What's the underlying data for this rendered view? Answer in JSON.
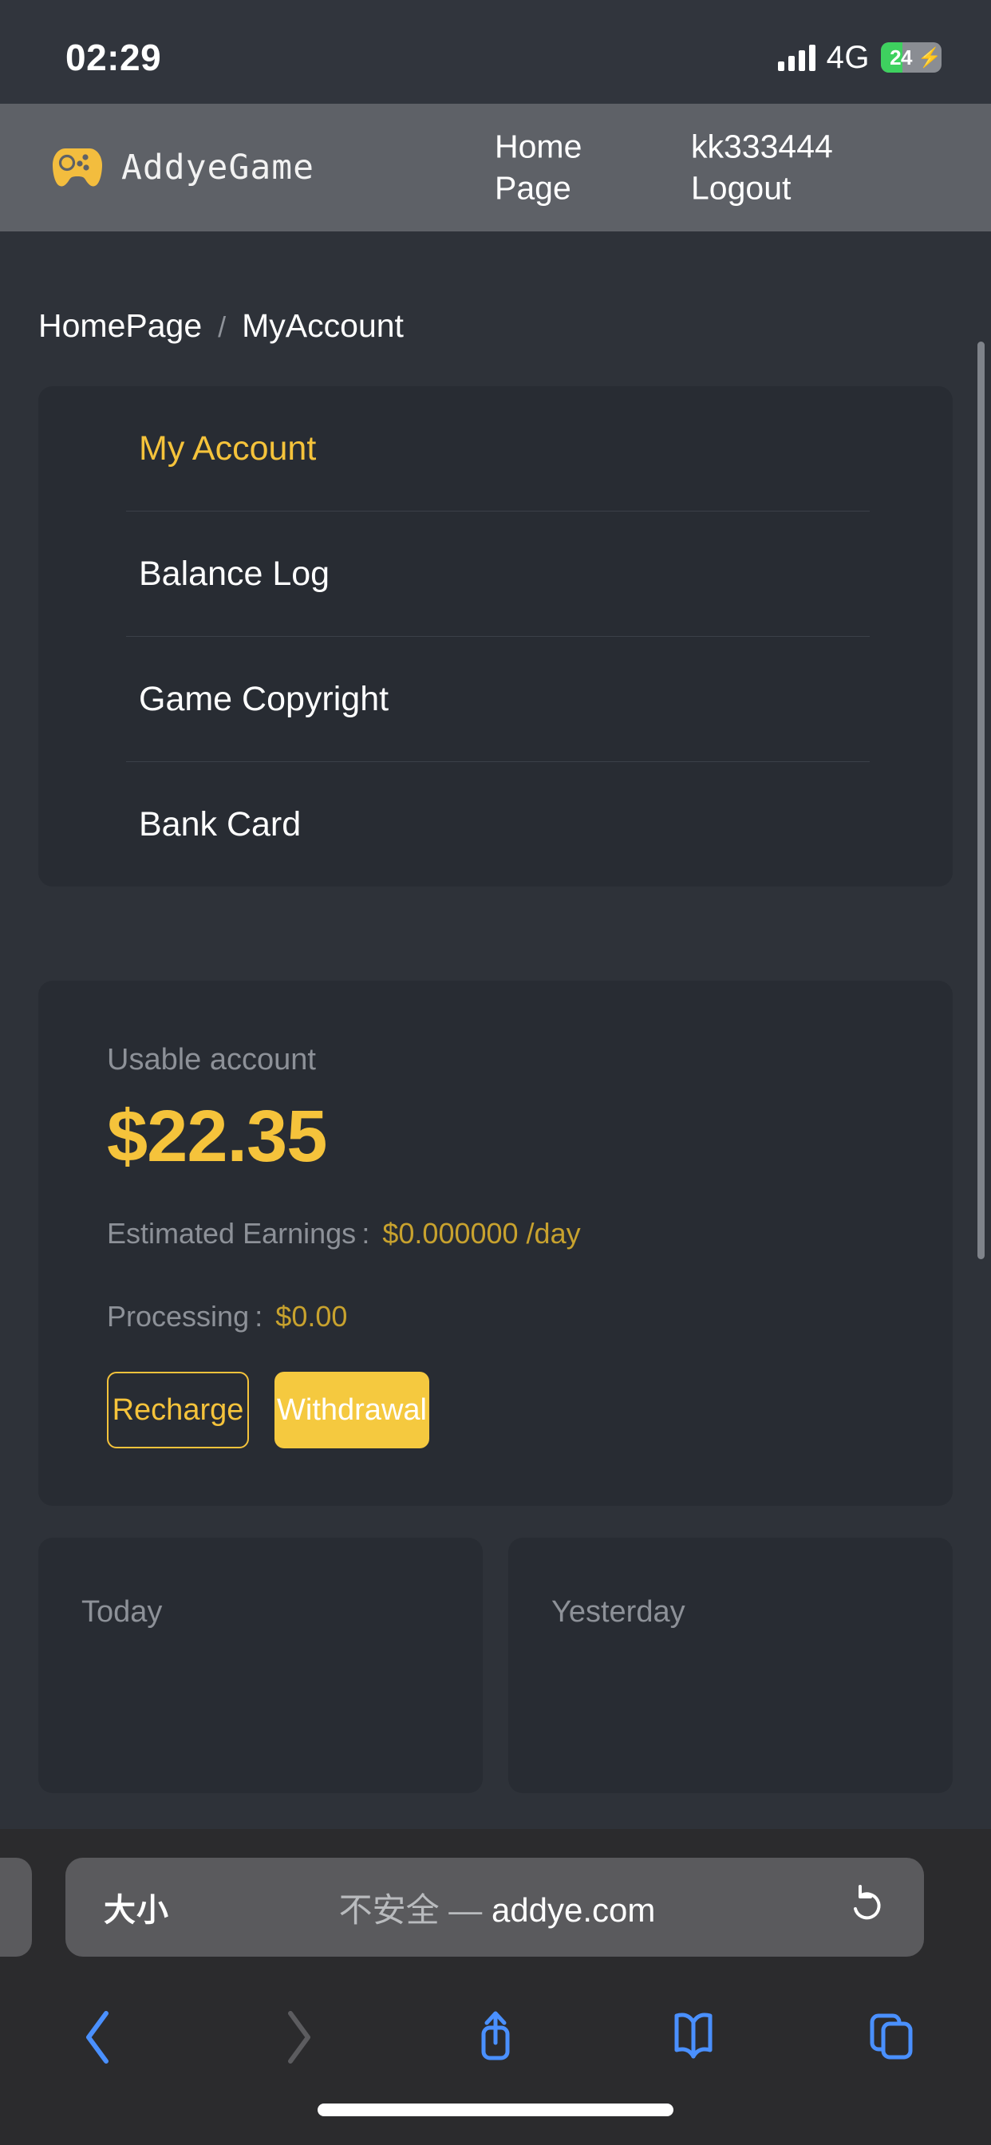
{
  "status_bar": {
    "time": "02:29",
    "network": "4G",
    "battery_percent": "24",
    "battery_charging_icon": "bolt-icon",
    "signal_icon": "signal-bars-icon"
  },
  "header": {
    "logo_icon": "gamepad-icon",
    "brand": "AddyeGame",
    "nav_home": "Home Page",
    "username": "kk333444",
    "logout": "Logout"
  },
  "breadcrumb": {
    "home": "HomePage",
    "separator": "/",
    "current": "MyAccount"
  },
  "menu": {
    "items": [
      {
        "label": "My Account",
        "active": true
      },
      {
        "label": "Balance Log",
        "active": false
      },
      {
        "label": "Game Copyright",
        "active": false
      },
      {
        "label": "Bank Card",
        "active": false
      }
    ]
  },
  "balance": {
    "usable_label": "Usable account",
    "amount": "$22.35",
    "earnings_label": "Estimated Earnings :",
    "earnings_value": "$0.000000 /day",
    "processing_label": "Processing :",
    "processing_value": "$0.00",
    "recharge_button": "Recharge",
    "withdrawal_button": "Withdrawal"
  },
  "stats": {
    "today_label": "Today",
    "yesterday_label": "Yesterday"
  },
  "browser": {
    "text_size_button": "大小",
    "insecure_label": "不安全",
    "dash": "—",
    "domain": "addye.com",
    "reload_icon": "reload-icon",
    "back_icon": "chevron-left-icon",
    "forward_icon": "chevron-right-icon",
    "share_icon": "share-icon",
    "bookmarks_icon": "book-icon",
    "tabs_icon": "tabs-icon"
  },
  "colors": {
    "accent": "#f5c33b",
    "page_bg": "#2e3239",
    "card_bg": "#282c33",
    "header_bg": "#5e6167",
    "browser_blue": "#4a90ff"
  }
}
